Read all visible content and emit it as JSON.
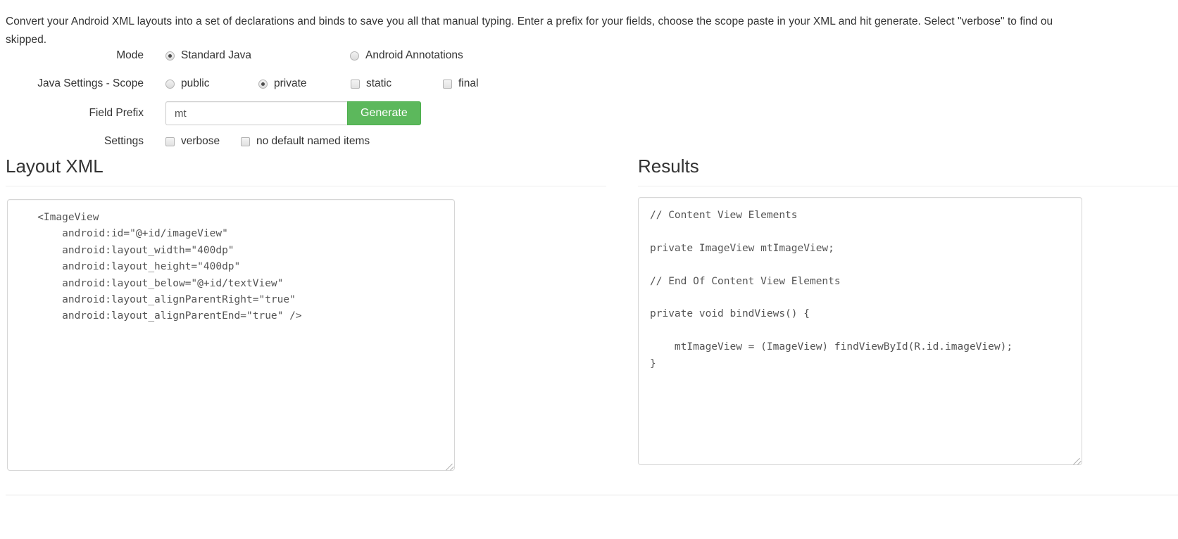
{
  "intro": {
    "text": "Convert your Android XML layouts into a set of declarations and binds to save you all that manual typing. Enter a prefix for your fields, choose the scope paste in your XML and hit generate. Select \"verbose\" to find ou\nskipped."
  },
  "form": {
    "mode": {
      "label": "Mode",
      "options": [
        {
          "label": "Standard Java",
          "type": "radio",
          "checked": true
        },
        {
          "label": "Android Annotations",
          "type": "radio",
          "checked": false
        }
      ]
    },
    "scope": {
      "label": "Java Settings - Scope",
      "options": [
        {
          "label": "public",
          "type": "radio",
          "checked": false
        },
        {
          "label": "private",
          "type": "radio",
          "checked": true
        },
        {
          "label": "static",
          "type": "checkbox",
          "checked": false
        },
        {
          "label": "final",
          "type": "checkbox",
          "checked": false
        }
      ]
    },
    "prefix": {
      "label": "Field Prefix",
      "value": "mt",
      "placeholder": "",
      "button_label": "Generate"
    },
    "settings": {
      "label": "Settings",
      "options": [
        {
          "label": "verbose",
          "type": "checkbox",
          "checked": false
        },
        {
          "label": "no default named items",
          "type": "checkbox",
          "checked": false
        }
      ]
    }
  },
  "layout_section": {
    "heading": "Layout XML",
    "xml": "   <ImageView\n       android:id=\"@+id/imageView\"\n       android:layout_width=\"400dp\"\n       android:layout_height=\"400dp\"\n       android:layout_below=\"@+id/textView\"\n       android:layout_alignParentRight=\"true\"\n       android:layout_alignParentEnd=\"true\" />"
  },
  "results_section": {
    "heading": "Results",
    "code": "// Content View Elements\n\nprivate ImageView mtImageView;\n\n// End Of Content View Elements\n\nprivate void bindViews() {\n\n    mtImageView = (ImageView) findViewById(R.id.imageView);\n}"
  },
  "colors": {
    "accent_green": "#5cb85c",
    "accent_green_border": "#4cae4c",
    "text": "#333333",
    "code_text": "#555555",
    "border": "#d6d6d6",
    "rule": "#eeeeee"
  }
}
